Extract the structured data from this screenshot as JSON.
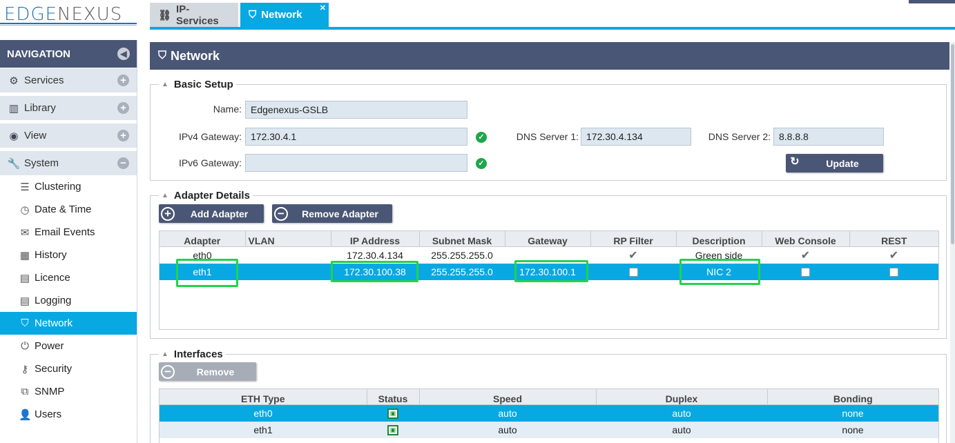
{
  "logo": {
    "part1": "EDGE",
    "part2": "NEXUS"
  },
  "tabs": [
    {
      "label": "IP-Services",
      "icon": "sitemap-icon"
    },
    {
      "label": "Network",
      "icon": "network-port-icon",
      "close": "✕"
    }
  ],
  "nav": {
    "title": "NAVIGATION",
    "groups": [
      {
        "label": "Services",
        "icon": "gear-icon"
      },
      {
        "label": "Library",
        "icon": "library-icon"
      },
      {
        "label": "View",
        "icon": "eye-icon"
      },
      {
        "label": "System",
        "icon": "wrench-icon"
      }
    ],
    "items": [
      "Clustering",
      "Date & Time",
      "Email Events",
      "History",
      "Licence",
      "Logging",
      "Network",
      "Power",
      "Security",
      "SNMP",
      "Users"
    ],
    "active": "Network"
  },
  "panel": {
    "title": "Network"
  },
  "basic": {
    "legend": "Basic Setup",
    "name_label": "Name:",
    "name_value": "Edgenexus-GSLB",
    "ipv4_label": "IPv4 Gateway:",
    "ipv4_value": "172.30.4.1",
    "ipv6_label": "IPv6 Gateway:",
    "ipv6_value": "",
    "dns1_label": "DNS Server 1:",
    "dns1_value": "172.30.4.134",
    "dns2_label": "DNS Server 2:",
    "dns2_value": "8.8.8.8",
    "update_label": "Update"
  },
  "adapters": {
    "legend": "Adapter Details",
    "add_label": "Add Adapter",
    "remove_label": "Remove Adapter",
    "columns": [
      "Adapter",
      "VLAN",
      "IP Address",
      "Subnet Mask",
      "Gateway",
      "RP Filter",
      "Description",
      "Web Console",
      "REST"
    ],
    "rows": [
      {
        "adapter": "eth0",
        "vlan": "",
        "ip": "172.30.4.134",
        "mask": "255.255.255.0",
        "gateway": "",
        "rp": true,
        "desc": "Green side",
        "web": true,
        "rest": true
      },
      {
        "adapter": "eth1",
        "vlan": "",
        "ip": "172.30.100.38",
        "mask": "255.255.255.0",
        "gateway": "172.30.100.1",
        "rp": false,
        "desc": "NIC 2",
        "web": false,
        "rest": false
      }
    ]
  },
  "interfaces": {
    "legend": "Interfaces",
    "remove_label": "Remove",
    "columns": [
      "ETH Type",
      "Status",
      "Speed",
      "Duplex",
      "Bonding"
    ],
    "rows": [
      {
        "eth": "eth0",
        "speed": "auto",
        "duplex": "auto",
        "bonding": "none"
      },
      {
        "eth": "eth1",
        "speed": "auto",
        "duplex": "auto",
        "bonding": "none"
      }
    ]
  },
  "colors": {
    "accent": "#08a9e3",
    "header": "#4a5675",
    "highlight": "#22d34a"
  }
}
